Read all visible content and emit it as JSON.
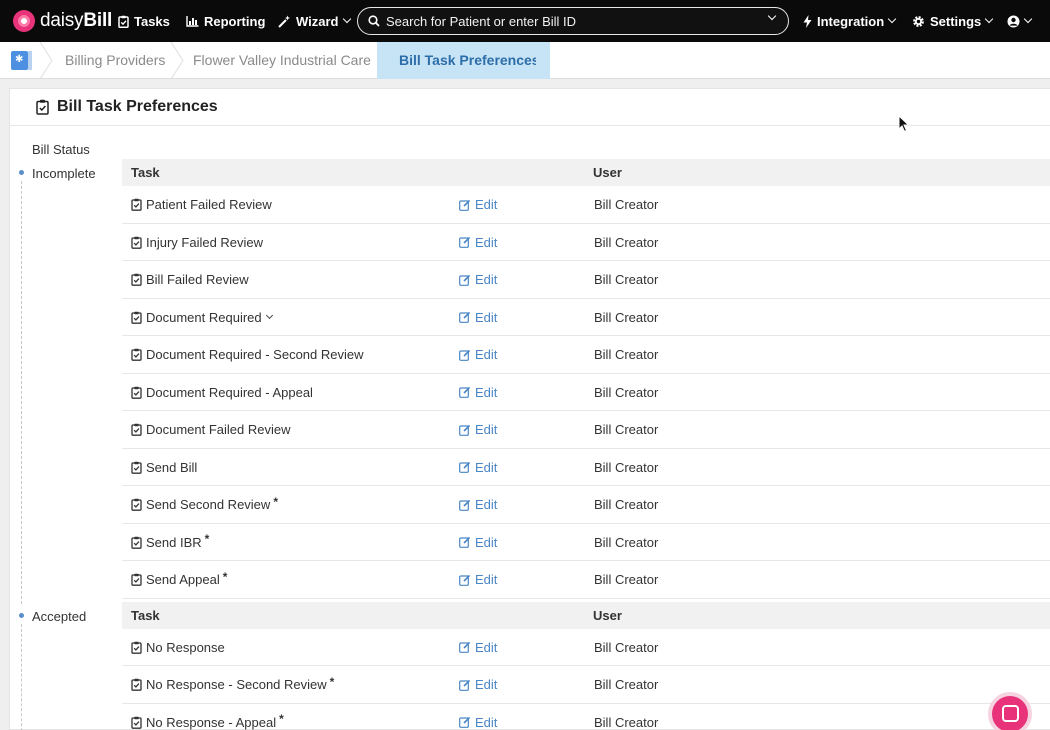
{
  "nav": {
    "logo_part1": "daisy",
    "logo_part2": "Bill",
    "tasks": "Tasks",
    "reporting": "Reporting",
    "wizard": "Wizard",
    "search_placeholder": "Search for Patient or enter Bill ID",
    "integration": "Integration",
    "settings": "Settings",
    "icons": [
      "daisy-flower-icon",
      "clipboard-check-icon",
      "bar-chart-icon",
      "magic-wand-icon",
      "search-icon",
      "bolt-icon",
      "gear-icon",
      "user-circle-icon"
    ]
  },
  "breadcrumb": {
    "items": [
      "Billing Providers",
      "Flower Valley Industrial Care"
    ],
    "active": "Bill Task Preferences"
  },
  "panel": {
    "title": "Bill Task Preferences",
    "bill_status_label": "Bill Status",
    "columns": {
      "task": "Task",
      "user": "User"
    },
    "edit_label": "Edit"
  },
  "groups": [
    {
      "status": "Incomplete",
      "rows": [
        {
          "task": "Patient Failed Review",
          "user": "Bill Creator",
          "star": false,
          "dropdown": false
        },
        {
          "task": "Injury Failed Review",
          "user": "Bill Creator",
          "star": false,
          "dropdown": false
        },
        {
          "task": "Bill Failed Review",
          "user": "Bill Creator",
          "star": false,
          "dropdown": false
        },
        {
          "task": "Document Required",
          "user": "Bill Creator",
          "star": false,
          "dropdown": true
        },
        {
          "task": "Document Required - Second Review",
          "user": "Bill Creator",
          "star": false,
          "dropdown": false
        },
        {
          "task": "Document Required - Appeal",
          "user": "Bill Creator",
          "star": false,
          "dropdown": false
        },
        {
          "task": "Document Failed Review",
          "user": "Bill Creator",
          "star": false,
          "dropdown": false
        },
        {
          "task": "Send Bill",
          "user": "Bill Creator",
          "star": false,
          "dropdown": false
        },
        {
          "task": "Send Second Review",
          "user": "Bill Creator",
          "star": true,
          "dropdown": false
        },
        {
          "task": "Send IBR",
          "user": "Bill Creator",
          "star": true,
          "dropdown": false
        },
        {
          "task": "Send Appeal",
          "user": "Bill Creator",
          "star": true,
          "dropdown": false
        }
      ]
    },
    {
      "status": "Accepted",
      "rows": [
        {
          "task": "No Response",
          "user": "Bill Creator",
          "star": false,
          "dropdown": false
        },
        {
          "task": "No Response - Second Review",
          "user": "Bill Creator",
          "star": true,
          "dropdown": false
        },
        {
          "task": "No Response - Appeal",
          "user": "Bill Creator",
          "star": true,
          "dropdown": false
        }
      ]
    }
  ],
  "star_symbol": "*",
  "colors": {
    "nav_bg": "#0a0a0a",
    "link": "#4a86c5",
    "brand": "#e8337a",
    "crumb_active_bg": "#c7e4f7",
    "crumb_active_text": "#2e6ea8"
  }
}
